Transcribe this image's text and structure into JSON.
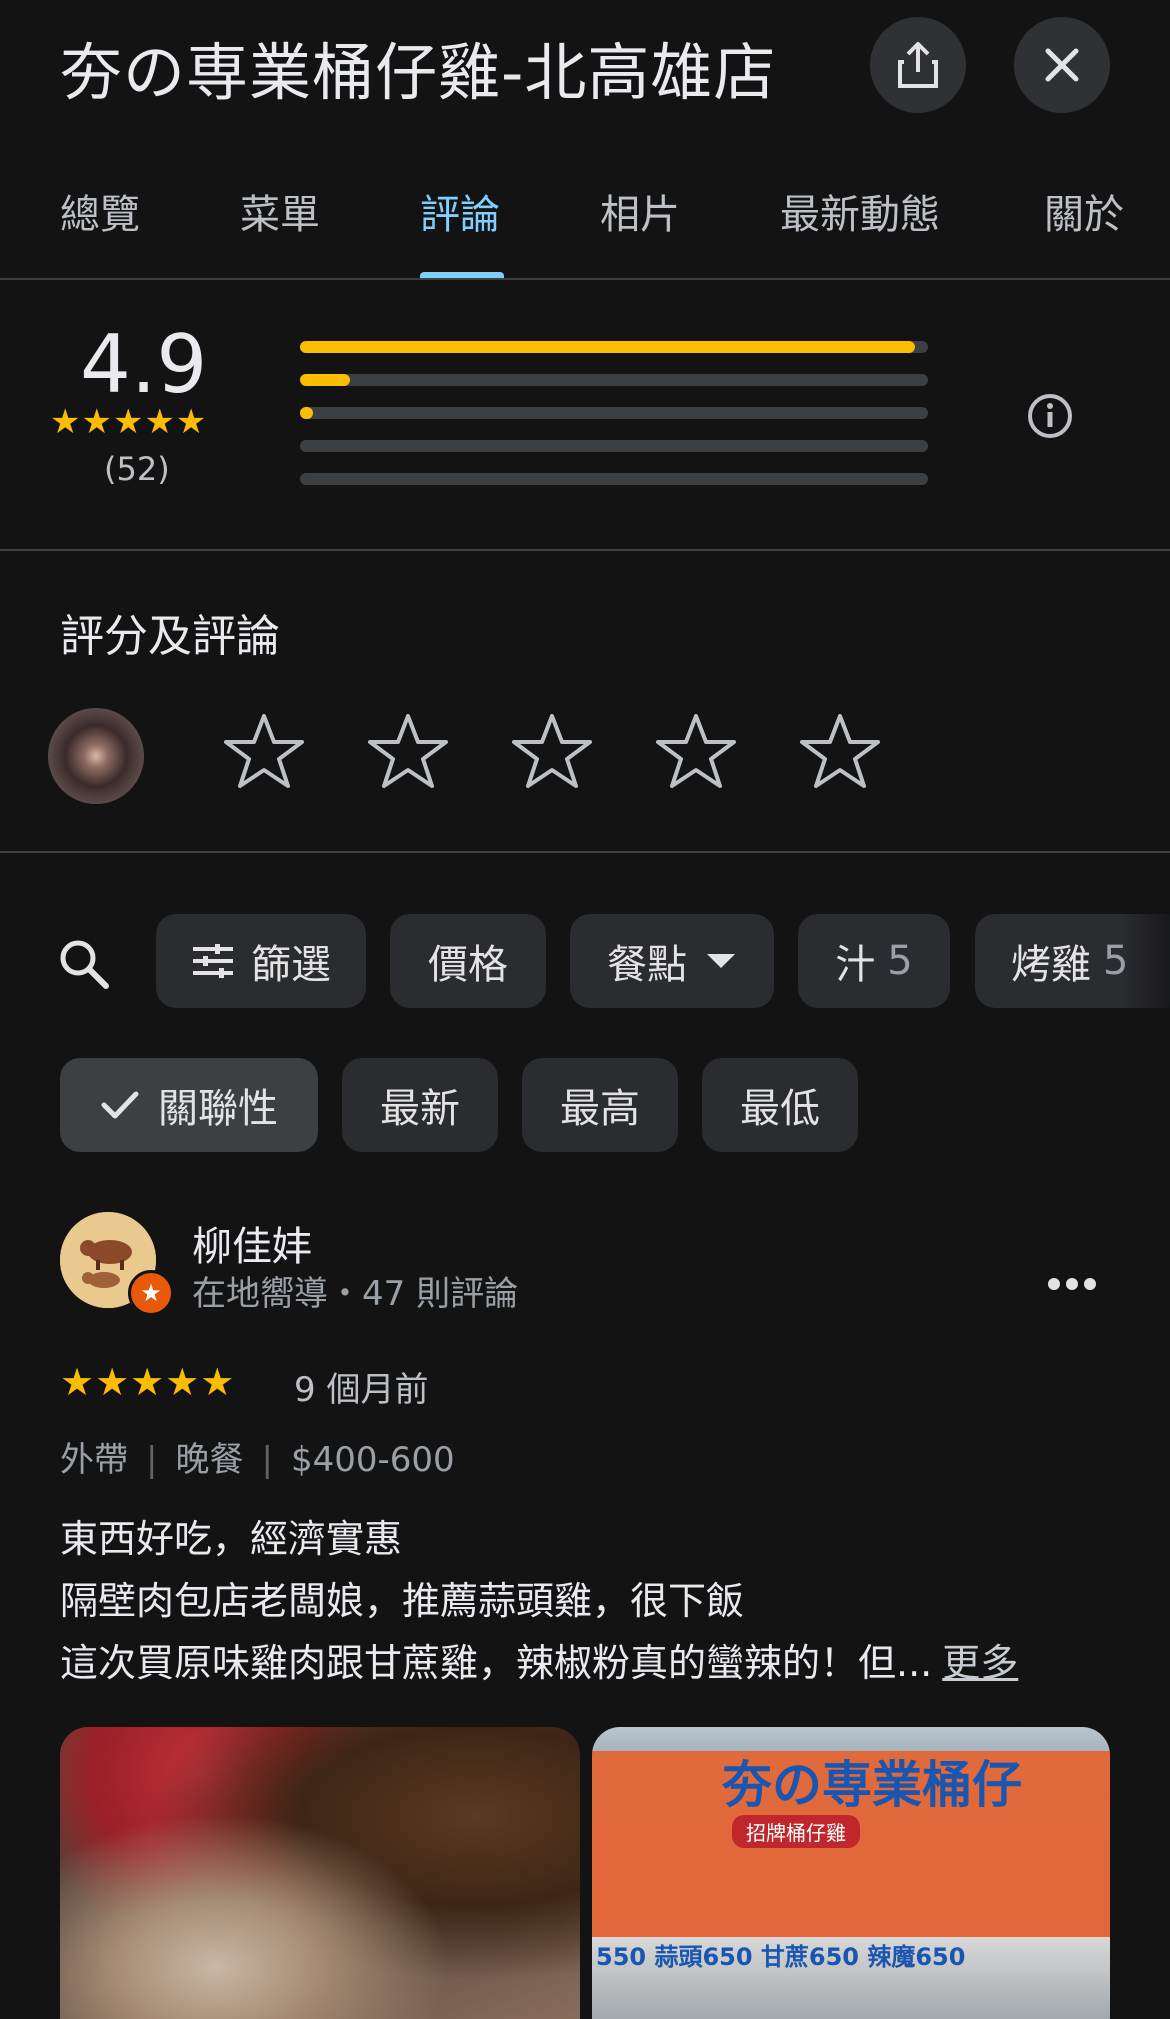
{
  "header": {
    "title": "夯の専業桶仔雞-北高雄店",
    "share_icon": "share-icon",
    "close_icon": "close-icon"
  },
  "tabs": [
    {
      "label": "總覽"
    },
    {
      "label": "菜單"
    },
    {
      "label": "評論",
      "active": true
    },
    {
      "label": "相片"
    },
    {
      "label": "最新動態"
    },
    {
      "label": "關於"
    }
  ],
  "summary": {
    "average": "4.9",
    "stars": "★★★★★",
    "count": "(52)",
    "distribution": [
      0.98,
      0.08,
      0.02,
      0.0,
      0.0
    ],
    "accent_color": "#fbbc04"
  },
  "your_review": {
    "title": "評分及評論",
    "empty_stars": [
      "☆",
      "☆",
      "☆",
      "☆",
      "☆"
    ]
  },
  "filters": {
    "chips": [
      {
        "label": "篩選"
      },
      {
        "label": "價格"
      },
      {
        "label": "餐點"
      },
      {
        "label": "汁",
        "count": "5"
      },
      {
        "label": "烤雞",
        "count": "5"
      }
    ],
    "sort": [
      {
        "label": "關聯性",
        "selected": true
      },
      {
        "label": "最新"
      },
      {
        "label": "最高"
      },
      {
        "label": "最低"
      }
    ]
  },
  "review": {
    "name": "柳佳妦",
    "meta": "在地嚮導・47 則評論",
    "stars": "★★★★★",
    "time": "9 個月前",
    "tags": [
      "外帶",
      "晚餐",
      "$400-600"
    ],
    "lines": [
      "東西好吃，經濟實惠",
      "隔壁肉包店老闆娘，推薦蒜頭雞，很下飯",
      "這次買原味雞肉跟甘蔗雞，辣椒粉真的蠻辣的！但..."
    ],
    "more": "更多",
    "photo2": {
      "sign": "夯の専業桶仔",
      "sub": "招牌桶仔雞",
      "prices": "550 蒜頭650 甘蔗650 辣魔650"
    }
  }
}
